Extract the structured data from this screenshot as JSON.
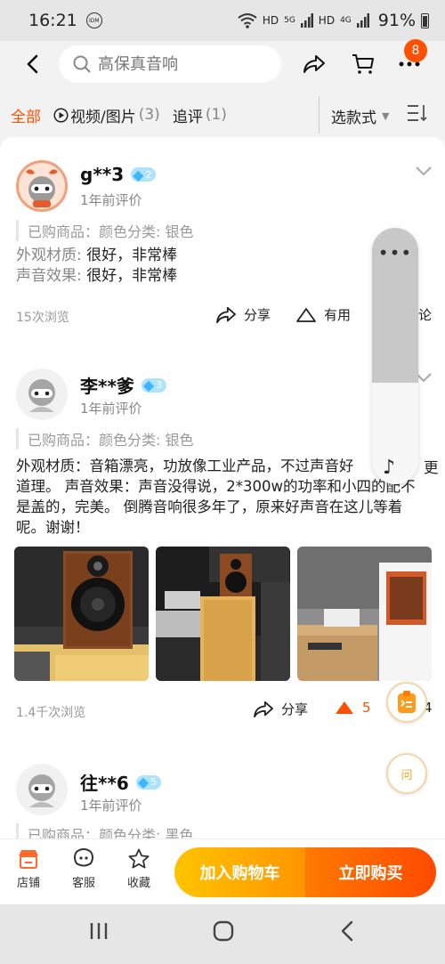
{
  "status_bar": {
    "time": "16:21",
    "id_badge": "IDM",
    "net1": "HD",
    "net1_gen": "5G",
    "net2": "HD",
    "net2_gen": "4G",
    "battery_pct": "91%"
  },
  "nav": {
    "search_placeholder": "高保真音响",
    "message_badge": "8"
  },
  "filters": {
    "all": "全部",
    "media": "视频/图片",
    "media_count": "(3)",
    "followup": "追评",
    "followup_count": "(1)",
    "style_select": "选款式"
  },
  "reviews": [
    {
      "user": "g**3",
      "level": "2",
      "time": "1年前评价",
      "purchased": "已购商品：颜色分类: 银色",
      "lines": [
        {
          "key": "外观材质: ",
          "value": "很好，非常棒"
        },
        {
          "key": "声音效果: ",
          "value": "很好，非常棒"
        }
      ],
      "views": "15次浏览",
      "share": "分享",
      "useful": "有用",
      "comment": "论"
    },
    {
      "user": "李**爹",
      "level": "3",
      "time": "1年前评价",
      "purchased": "已购商品：颜色分类: 银色",
      "text": "外观材质：音箱漂亮，功放像工业产品，不过声音好",
      "text_cont": "道理。 声音效果：声音没得说，2*300w的功率和小四的配不是盖的，完美。 倒腾音响很多年了，原来好声音在这儿等着呢。谢谢！",
      "text_edge": "更",
      "views": "1.4千次浏览",
      "share": "分享",
      "likes": "5",
      "comments": "4"
    },
    {
      "user": "往**6",
      "level": "5",
      "time": "1年前评价",
      "purchased": "已购商品：颜色分类: 黑色"
    }
  ],
  "bottom": {
    "store": "店铺",
    "service": "客服",
    "favorite": "收藏",
    "add_cart": "加入购物车",
    "buy_now": "立即购买",
    "ask_icon_label": "问"
  },
  "colors": {
    "accent": "#ff5000",
    "diamond": "#3fb5ff"
  }
}
